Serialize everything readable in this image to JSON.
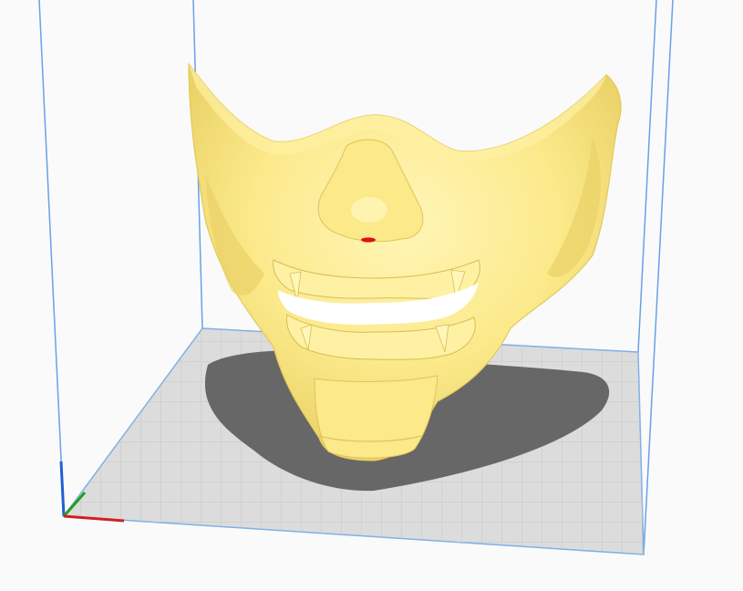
{
  "app": {
    "view": "slicer-3d-viewport"
  },
  "scene": {
    "model": {
      "name_icon": "samurai-mask-model",
      "color": "#fbe98a",
      "shade_color": "#ead267",
      "highlight_color": "#fff6b8",
      "marker_color": "#e01010"
    },
    "build_plate": {
      "color": "#dcdcdc",
      "grid_color": "#c4c4c4",
      "edge_color": "#7fb0e6"
    },
    "build_volume": {
      "edge_color": "#6aa0e8"
    },
    "axes": {
      "x_color": "#d02020",
      "y_color": "#20a020",
      "z_color": "#2060d0"
    },
    "shadow_color": "#5a5a5a",
    "background": "#fafafa"
  }
}
